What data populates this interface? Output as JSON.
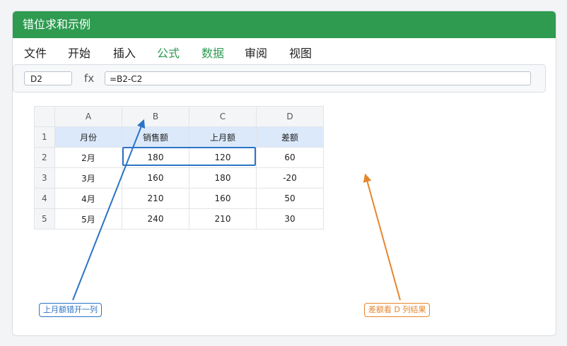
{
  "window": {
    "title": "错位求和示例"
  },
  "menu": {
    "items": [
      {
        "label": "文件"
      },
      {
        "label": "开始"
      },
      {
        "label": "插入"
      },
      {
        "label": "公式"
      },
      {
        "label": "数据"
      },
      {
        "label": "审阅"
      },
      {
        "label": "视图"
      }
    ]
  },
  "formula_bar": {
    "cell_ref": "D2",
    "fx": "fx",
    "formula": "=B2-C2"
  },
  "sheet": {
    "columns": [
      "A",
      "B",
      "C",
      "D"
    ],
    "row_numbers": [
      "1",
      "2",
      "3",
      "4",
      "5"
    ],
    "rows": [
      [
        "月份",
        "销售额",
        "上月额",
        "差额"
      ],
      [
        "2月",
        "180",
        "120",
        "60"
      ],
      [
        "3月",
        "160",
        "180",
        "-20"
      ],
      [
        "4月",
        "210",
        "160",
        "50"
      ],
      [
        "5月",
        "240",
        "210",
        "30"
      ]
    ]
  },
  "annotations": {
    "left_note": "上月额错开一列",
    "right_note": "差额看 D 列结果"
  },
  "colors": {
    "accent_green": "#2e9b51",
    "highlight_blue": "#2b74c7",
    "note_orange": "#e6862b",
    "header_fill": "#dbe9fb"
  }
}
